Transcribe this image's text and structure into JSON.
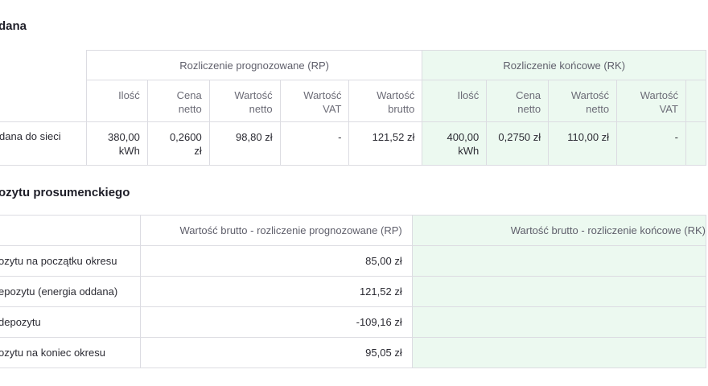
{
  "section1": {
    "title": "dana",
    "group_rp": "Rozliczenie prognozowane (RP)",
    "group_rk": "Rozliczenie końcowe (RK)",
    "rp_columns": {
      "ilosc": "Ilość",
      "cena_1": "Cena",
      "cena_2": "netto",
      "wn_1": "Wartość",
      "wn_2": "netto",
      "wv_1": "Wartość",
      "wv_2": "VAT",
      "wb_1": "Wartość",
      "wb_2": "brutto"
    },
    "rk_columns": {
      "ilosc": "Ilość",
      "cena_1": "Cena",
      "cena_2": "netto",
      "wn_1": "Wartość",
      "wn_2": "netto",
      "wv_1": "Wartość",
      "wv_2": "VAT"
    },
    "row": {
      "label": "dana do sieci",
      "rp": {
        "ilosc_1": "380,00",
        "ilosc_2": "kWh",
        "cena_1": "0,2600",
        "cena_2": "zł",
        "wartosc_netto": "98,80 zł",
        "wartosc_vat": "-",
        "wartosc_brutto": "121,52 zł"
      },
      "rk": {
        "ilosc_1": "400,00",
        "ilosc_2": "kWh",
        "cena": "0,2750 zł",
        "wartosc_netto": "110,00 zł",
        "wartosc_vat": "-"
      }
    }
  },
  "section2": {
    "title": "ozytu prosumenckiego",
    "header_rp": "Wartość brutto - rozliczenie prognozowane (RP)",
    "header_rk": "Wartość brutto - rozliczenie końcowe (RK)",
    "rows": [
      {
        "label": "ozytu na początku okresu",
        "rp": "85,00 zł"
      },
      {
        "label": "epozytu (energia oddana)",
        "rp": "121,52 zł"
      },
      {
        "label": "depozytu",
        "rp": "-109,16 zł"
      },
      {
        "label": "ozytu na koniec okresu",
        "rp": "95,05 zł"
      }
    ]
  },
  "colors": {
    "rk_background": "#ecf9f0",
    "border": "#dcdce2",
    "text": "#2b2b33",
    "muted_text": "#6c6c77"
  }
}
